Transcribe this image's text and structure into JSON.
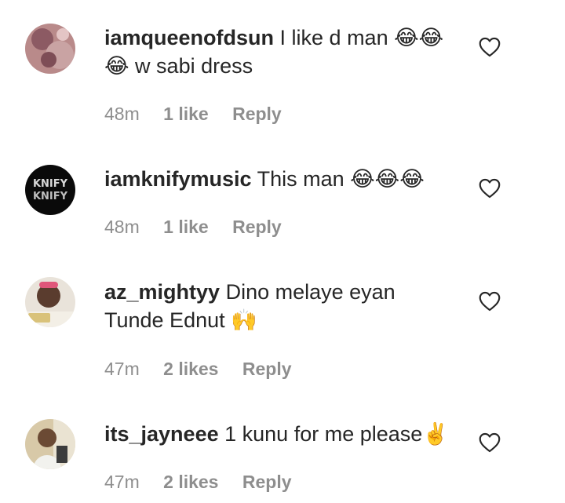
{
  "comments": [
    {
      "username": "iamqueenofdsun",
      "text_line1": "I like d man 😂😂",
      "text_line2": "😂 w sabi dress",
      "time": "48m",
      "likes": "1 like",
      "reply": "Reply"
    },
    {
      "username": "iamknifymusic",
      "text_line1": "This man 😂😂😂",
      "text_line2": "",
      "time": "48m",
      "likes": "1 like",
      "reply": "Reply"
    },
    {
      "username": "az_mightyy",
      "text_line1": "Dino melaye eyan",
      "text_line2": "Tunde Ednut 🙌",
      "time": "47m",
      "likes": "2 likes",
      "reply": "Reply"
    },
    {
      "username": "its_jayneee",
      "text_line1": "1 kunu for me please✌️",
      "text_line2": "",
      "time": "47m",
      "likes": "2 likes",
      "reply": "Reply"
    }
  ],
  "avatars": {
    "knify_text": "KNIFY"
  },
  "colors": {
    "text": "#262626",
    "meta": "#8e8e8e",
    "background": "#ffffff"
  }
}
